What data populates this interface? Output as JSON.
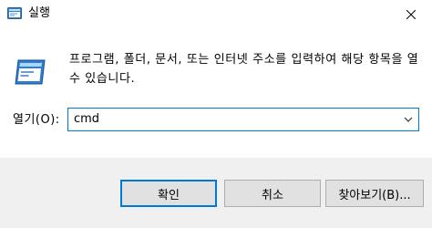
{
  "window": {
    "title": "실행",
    "close_icon": "close-icon",
    "app_icon": "run-dialog-icon"
  },
  "content": {
    "description": "프로그램, 폴더, 문서, 또는 인터넷 주소를 입력하여 해당 항목을 열 수 있습니다.",
    "open_label": "열기(O):",
    "input_value": "cmd",
    "dropdown_icon": "chevron-down-icon"
  },
  "buttons": {
    "ok": "확인",
    "cancel": "취소",
    "browse": "찾아보기(B)..."
  },
  "colors": {
    "accent": "#0078d7",
    "footer_bg": "#f0f0f0",
    "button_bg": "#e1e1e1",
    "button_border": "#adadad"
  }
}
